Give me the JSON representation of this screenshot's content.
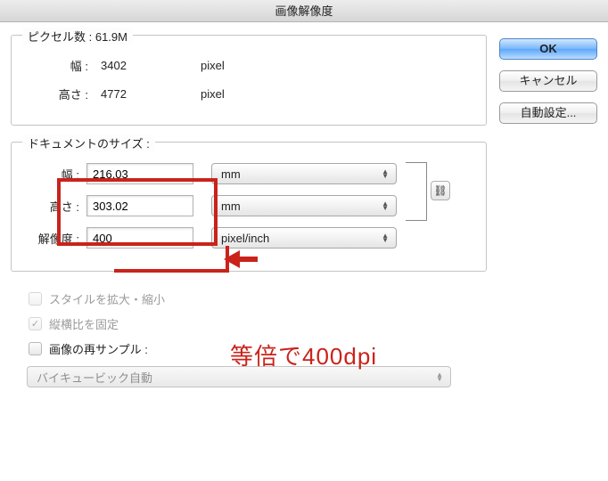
{
  "window": {
    "title": "画像解像度"
  },
  "pixel_dims": {
    "group_label": "ピクセル数 : 61.9M",
    "width_label": "幅 :",
    "width_value": "3402",
    "width_unit": "pixel",
    "height_label": "高さ :",
    "height_value": "4772",
    "height_unit": "pixel"
  },
  "doc_size": {
    "group_label": "ドキュメントのサイズ :",
    "width_label": "幅 :",
    "width_value": "216.03",
    "width_unit": "mm",
    "height_label": "高さ :",
    "height_value": "303.02",
    "height_unit": "mm",
    "res_label": "解像度 :",
    "res_value": "400",
    "res_unit": "pixel/inch",
    "link_icon": "⛓"
  },
  "checks": {
    "scale_styles": "スタイルを拡大・縮小",
    "constrain": "縦横比を固定",
    "resample": "画像の再サンプル :"
  },
  "resample_method": "バイキュービック自動",
  "buttons": {
    "ok": "OK",
    "cancel": "キャンセル",
    "auto": "自動設定..."
  },
  "annotation": "等倍で400dpi"
}
